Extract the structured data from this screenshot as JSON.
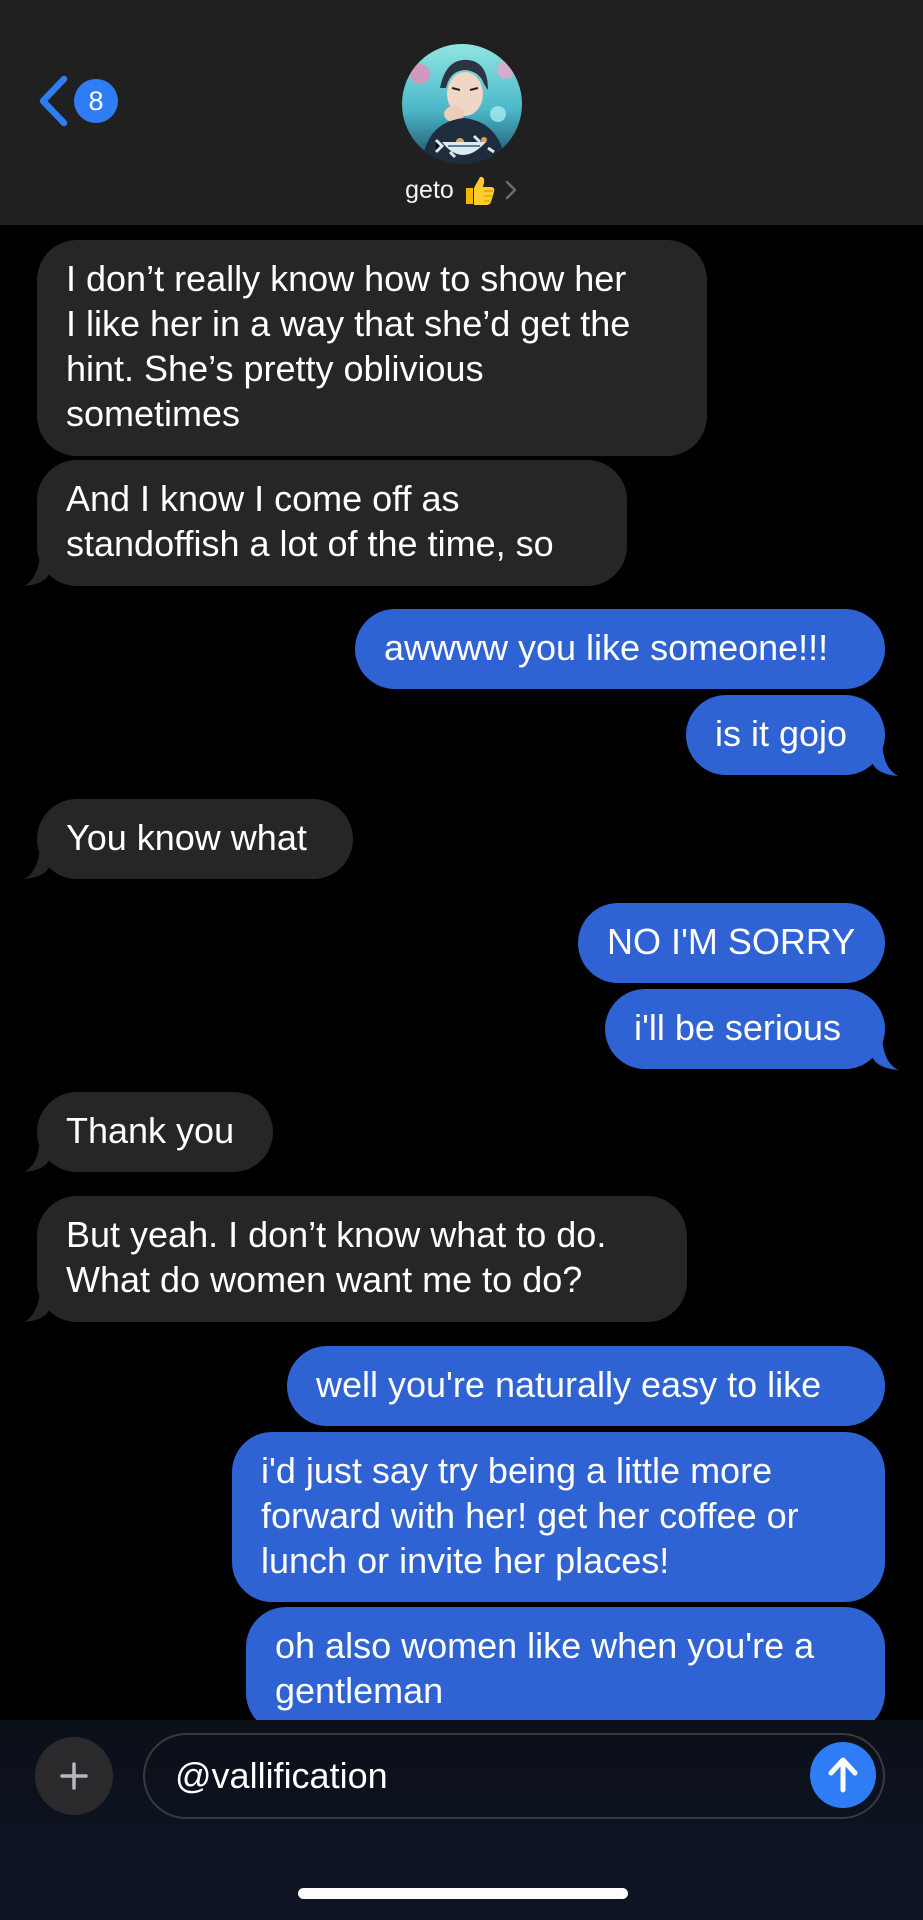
{
  "header": {
    "back_badge_count": "8",
    "contact_name": "geto",
    "contact_emoji_icon": "thumbs-up-emoji"
  },
  "colors": {
    "incoming_bubble": "#262629",
    "outgoing_bubble": "#2f62d3",
    "accent": "#2e7cf6",
    "background": "#000000",
    "header_background": "#202020"
  },
  "messages": [
    {
      "direction": "incoming",
      "text": "I don’t really know how to show her\nI like her in a way that she’d get the\nhint. She’s pretty oblivious\nsometimes"
    },
    {
      "direction": "incoming",
      "text": "And I know I come off as\nstandoffish a lot of the time, so"
    },
    {
      "direction": "outgoing",
      "text": "awwww you like someone!!!"
    },
    {
      "direction": "outgoing",
      "text": "is it gojo"
    },
    {
      "direction": "incoming",
      "text": "You know what"
    },
    {
      "direction": "outgoing",
      "text": "NO I'M SORRY"
    },
    {
      "direction": "outgoing",
      "text": "i'll be serious"
    },
    {
      "direction": "incoming",
      "text": "Thank you"
    },
    {
      "direction": "incoming",
      "text": "But yeah. I don’t know what to do.\nWhat do women want me to do?"
    },
    {
      "direction": "outgoing",
      "text": "well you're naturally easy to like"
    },
    {
      "direction": "outgoing",
      "text": "i'd just say try being a little more\nforward with her! get her coffee or\nlunch or invite her places!"
    },
    {
      "direction": "outgoing",
      "text": "oh also women like when you're a\ngentleman"
    }
  ],
  "composer": {
    "input_value": "@vallification",
    "plus_icon": "plus-icon",
    "send_icon": "arrow-up-icon"
  }
}
